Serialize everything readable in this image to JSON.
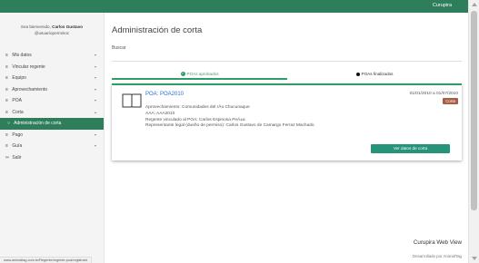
{
  "header": {
    "brand": "Curupira"
  },
  "sidebar": {
    "welcome_prefix": "Sea bienvenido,",
    "user_name": "Carlos Gustavo",
    "user_handle": "@usuariopermisoc",
    "items": [
      {
        "label": "Mis datos",
        "icon": "list-icon",
        "chevron": "chevron-down-icon"
      },
      {
        "label": "Vincular regente",
        "icon": "list-icon",
        "chevron": "chevron-down-icon"
      },
      {
        "label": "Equipo",
        "icon": "list-icon",
        "chevron": "chevron-down-icon"
      },
      {
        "label": "Aprovechamiento",
        "icon": "list-icon",
        "chevron": "chevron-down-icon"
      },
      {
        "label": "POA",
        "icon": "list-icon",
        "chevron": "chevron-down-icon"
      },
      {
        "label": "Corta",
        "icon": "list-icon",
        "chevron": "chevron-up-icon"
      },
      {
        "label": "Administración de corta",
        "icon": "circle-icon",
        "active": true
      },
      {
        "label": "Pago",
        "icon": "list-icon",
        "chevron": "chevron-down-icon"
      },
      {
        "label": "Guía",
        "icon": "list-icon",
        "chevron": "chevron-down-icon"
      },
      {
        "label": "Salir",
        "icon": "exit-icon"
      }
    ]
  },
  "main": {
    "title": "Administración de corta",
    "search": {
      "label": "Buscar",
      "value": "",
      "placeholder": ""
    },
    "tabs": [
      {
        "label": "POAs aprobados",
        "icon": "check-circle-icon",
        "active": true
      },
      {
        "label": "POAs finalizados",
        "icon": "dot-icon",
        "active": false
      }
    ],
    "card": {
      "icon": "book-icon",
      "title": "POA: POA2010",
      "date_range": "01/01/2010 a 01/07/2010",
      "badge": "Corta",
      "aprovechamiento": "Aprovechamiento: Comunidades del rÃo Chucunaque",
      "aaa": "AAA: AAA2010",
      "regente": "Regente vinculado al POA: Carlos Espinosa PeÃ±a",
      "representante": "Representante legal (dueño de permiso): Carlos Gustavo de Camargo Ferraz Machado",
      "button_label": "Ver datos de corta"
    }
  },
  "footer": {
    "title": "Curupira Web View",
    "credit": "Desarrollado por AnimalTag"
  },
  "status_url": "www.animaltag.com.br/Regente/regente-poa/registrar#"
}
